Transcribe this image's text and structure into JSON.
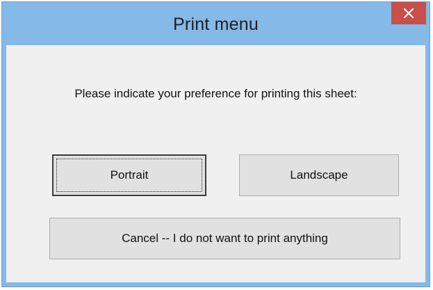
{
  "window": {
    "title": "Print menu",
    "close_icon": "close-icon",
    "colors": {
      "frame": "#84b9e8",
      "close_button": "#c7504b",
      "client_background": "#f0f0f0"
    }
  },
  "dialog": {
    "prompt": "Please indicate your preference for printing this sheet:",
    "buttons": {
      "portrait": "Portrait",
      "landscape": "Landscape",
      "cancel": "Cancel -- I do not want to print anything"
    }
  }
}
